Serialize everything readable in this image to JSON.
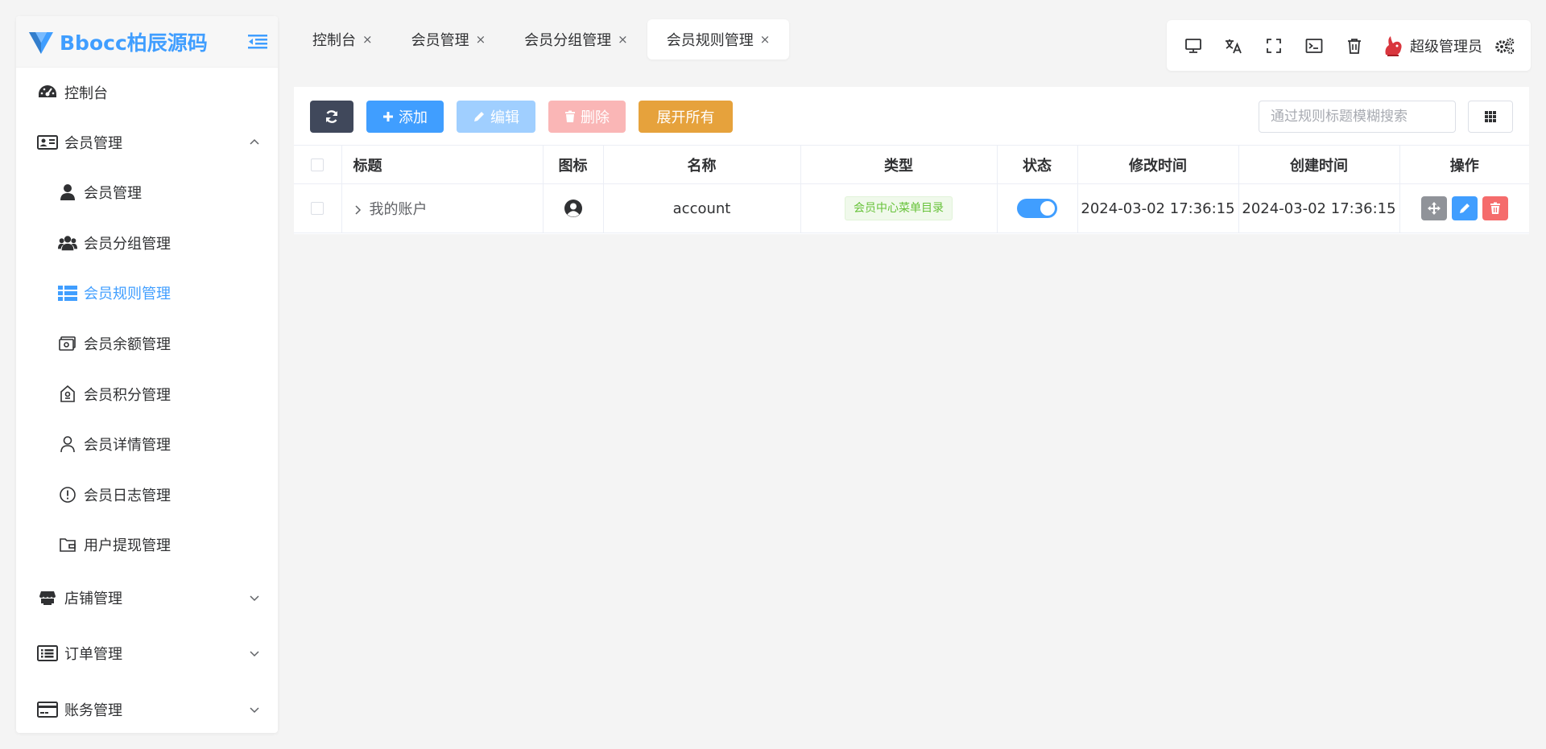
{
  "brand": {
    "name": "Bbocc柏辰源码",
    "accent": "#409eff"
  },
  "sidebar": {
    "items": [
      {
        "label": "控制台",
        "icon": "dashboard-icon"
      },
      {
        "label": "会员管理",
        "icon": "id-card-icon",
        "expanded": true,
        "children": [
          {
            "label": "会员管理",
            "icon": "user-icon"
          },
          {
            "label": "会员分组管理",
            "icon": "users-icon"
          },
          {
            "label": "会员规则管理",
            "icon": "list-icon",
            "active": true
          },
          {
            "label": "会员余额管理",
            "icon": "wallet-icon"
          },
          {
            "label": "会员积分管理",
            "icon": "tag-icon"
          },
          {
            "label": "会员详情管理",
            "icon": "person-outline-icon"
          },
          {
            "label": "会员日志管理",
            "icon": "alert-circle-icon"
          },
          {
            "label": "用户提现管理",
            "icon": "folder-wallet-icon"
          }
        ]
      },
      {
        "label": "店铺管理",
        "icon": "store-icon"
      },
      {
        "label": "订单管理",
        "icon": "list-alt-icon"
      },
      {
        "label": "账务管理",
        "icon": "credit-card-icon"
      }
    ]
  },
  "tabs": [
    {
      "label": "控制台",
      "close": "×"
    },
    {
      "label": "会员管理",
      "close": "×"
    },
    {
      "label": "会员分组管理",
      "close": "×"
    },
    {
      "label": "会员规则管理",
      "close": "×",
      "active": true
    }
  ],
  "topbar": {
    "icons": [
      "monitor-icon",
      "translate-icon",
      "fullscreen-icon",
      "terminal-icon",
      "trash-icon"
    ],
    "user": "超级管理员",
    "settings_icon": "gears-icon"
  },
  "toolbar": {
    "add": "添加",
    "edit": "编辑",
    "delete": "删除",
    "expand_all": "展开所有",
    "search_placeholder": "通过规则标题模糊搜索"
  },
  "table": {
    "headers": {
      "title": "标题",
      "icon": "图标",
      "name": "名称",
      "type": "类型",
      "status": "状态",
      "updated": "修改时间",
      "created": "创建时间",
      "ops": "操作"
    },
    "rows": [
      {
        "title": "我的账户",
        "icon": "user-circle-icon",
        "name": "account",
        "type": "会员中心菜单目录",
        "status": true,
        "updated": "2024-03-02 17:36:15",
        "created": "2024-03-02 17:36:15"
      }
    ]
  }
}
